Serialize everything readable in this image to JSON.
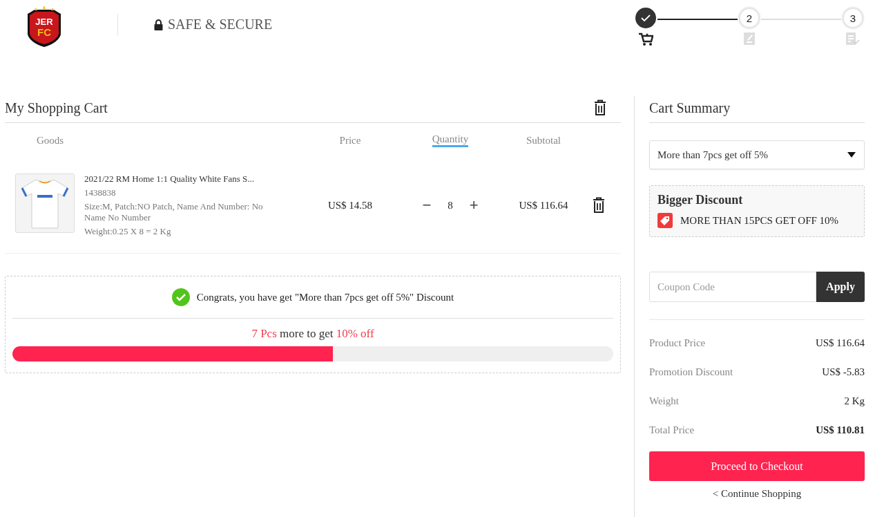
{
  "header": {
    "logo": {
      "line1": "JER",
      "line2": "FC"
    },
    "secure_label": "SAFE & SECURE",
    "steps": [
      {
        "kind": "cart",
        "done": true
      },
      {
        "kind": "edit",
        "label": "2",
        "done": false
      },
      {
        "kind": "review",
        "label": "3",
        "done": false
      }
    ]
  },
  "cart": {
    "title": "My Shopping Cart",
    "columns": [
      {
        "label": "Goods",
        "selected": false
      },
      {
        "label": "Price",
        "selected": false
      },
      {
        "label": "Quantity",
        "selected": true
      },
      {
        "label": "Subtotal",
        "selected": false
      }
    ],
    "items": [
      {
        "name": "2021/22 RM Home 1:1 Quality White Fans S...",
        "sku": "1438838",
        "options": "Size:M, Patch:NO Patch, Name And Number: No Name No Number",
        "weight": "Weight:0.25 X 8 = 2 Kg",
        "price": "US$ 14.58",
        "decrement": "−",
        "quantity": "8",
        "increment": "+",
        "subtotal": "US$ 116.64"
      }
    ],
    "promo": {
      "message": "Congrats, you have get \"More than 7pcs get off 5%\" Discount",
      "progress_parts": [
        {
          "text": "7 Pcs",
          "highlight": true
        },
        {
          "text": "more to get",
          "highlight": false
        },
        {
          "text": "10% off",
          "highlight": true
        }
      ],
      "level": 0.533
    }
  },
  "summary": {
    "title": "Cart Summary",
    "discount_select": "More than 7pcs get off 5%",
    "bigger_discount": {
      "title": "Bigger Discount",
      "offer": "MORE THAN 15PCS GET OFF 10%"
    },
    "coupon": {
      "placeholder": "Coupon Code",
      "button": "Apply"
    },
    "lines": [
      {
        "label": "Product Price",
        "value": "US$ 116.64",
        "bold": false
      },
      {
        "label": "Promotion Discount",
        "value": "US$ -5.83",
        "bold": false
      },
      {
        "label": "Weight",
        "value": "2 Kg",
        "bold": false
      },
      {
        "label": "Total Price",
        "value": "US$ 110.81",
        "bold": true
      }
    ],
    "checkout": "Proceed to Checkout",
    "continue": "< Continue Shopping"
  }
}
